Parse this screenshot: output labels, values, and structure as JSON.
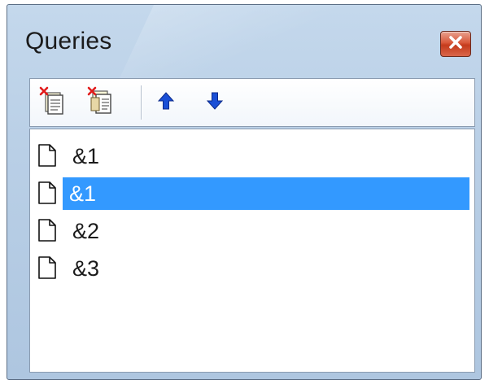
{
  "window": {
    "title": "Queries",
    "close_label": "×"
  },
  "toolbar": {
    "buttons": [
      {
        "name": "delete-query",
        "icon": "delete-document-icon"
      },
      {
        "name": "delete-all-queries",
        "icon": "delete-multiple-documents-icon"
      },
      {
        "name": "move-up",
        "icon": "arrow-up-icon"
      },
      {
        "name": "move-down",
        "icon": "arrow-down-icon"
      }
    ]
  },
  "queries": {
    "items": [
      {
        "label": "&1",
        "selected": false,
        "icon": "document-icon"
      },
      {
        "label": "&1",
        "selected": true,
        "icon": "document-icon"
      },
      {
        "label": "&2",
        "selected": false,
        "icon": "document-icon"
      },
      {
        "label": "&3",
        "selected": false,
        "icon": "document-icon"
      }
    ]
  },
  "colors": {
    "selection": "#3399ff",
    "titlebar": "#b9cfe6",
    "close_button": "#d9583a",
    "arrow": "#1a4fd6"
  }
}
